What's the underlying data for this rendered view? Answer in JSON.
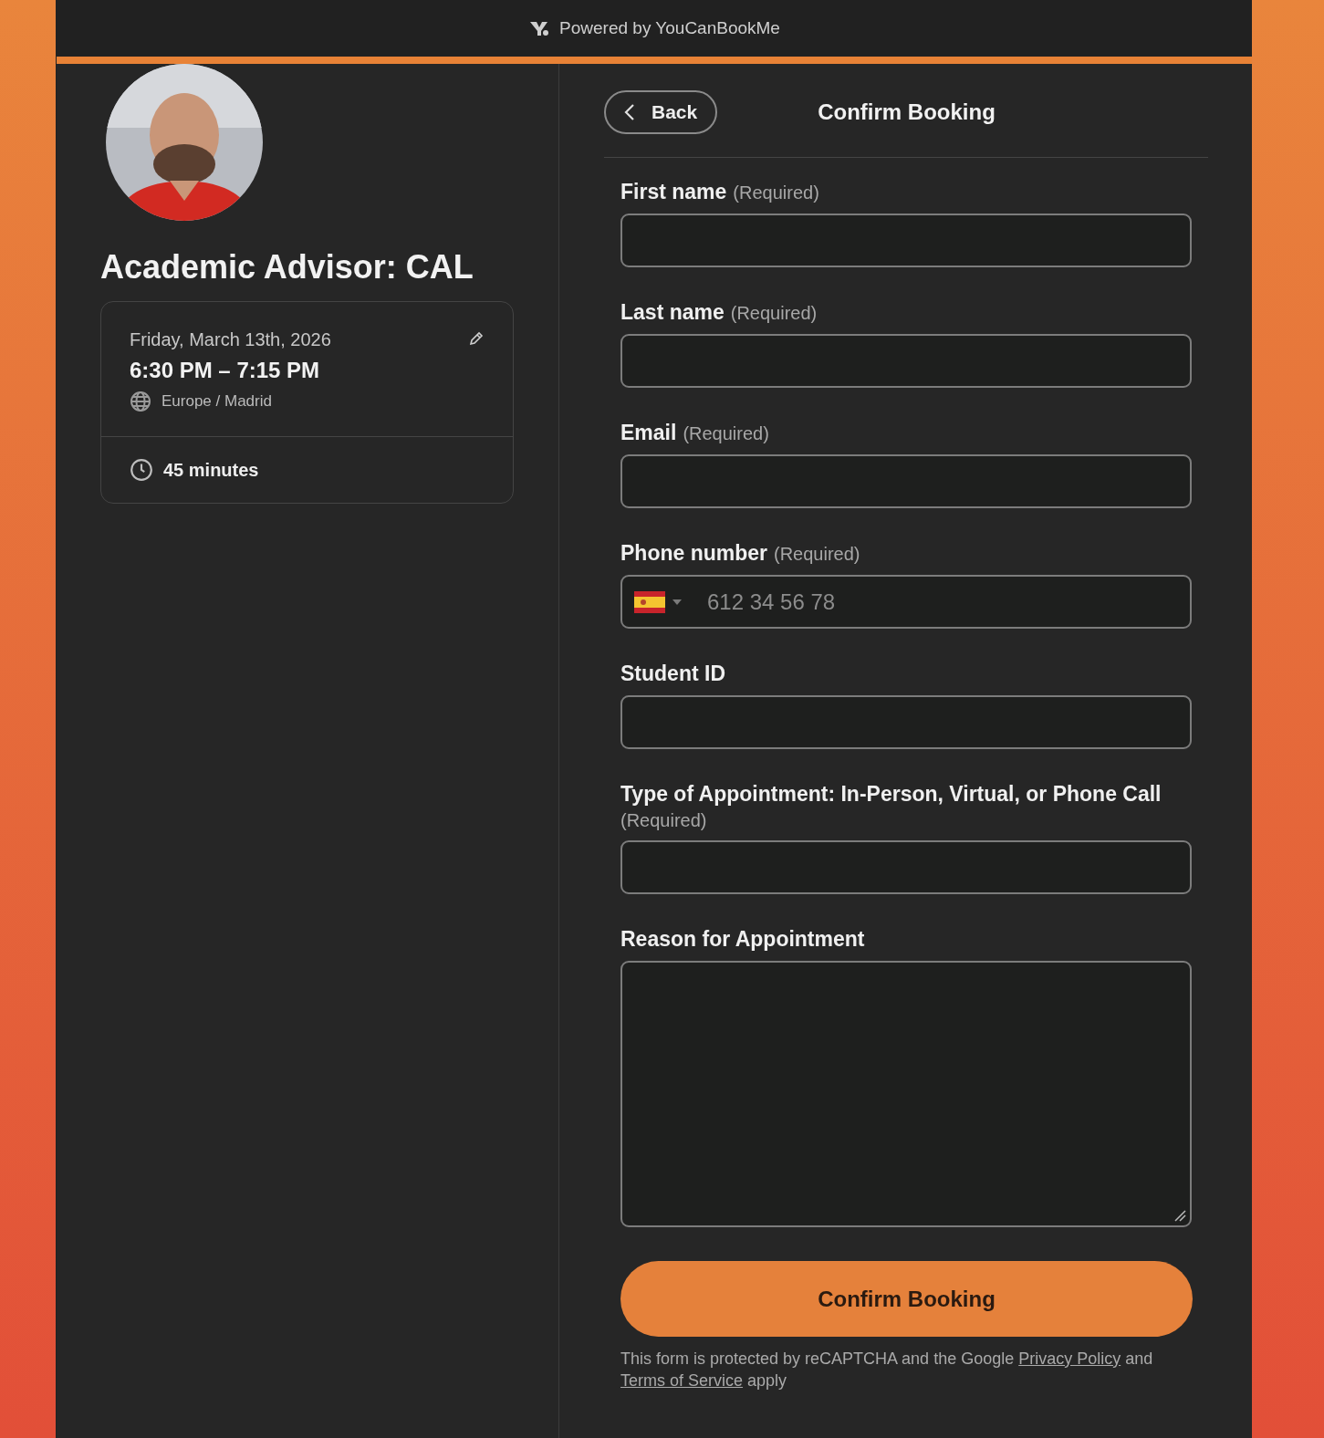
{
  "header": {
    "text": "Powered by YouCanBookMe"
  },
  "profile": {
    "title": "Academic Advisor: CAL"
  },
  "booking": {
    "date": "Friday, March 13th, 2026",
    "time": "6:30 PM – 7:15 PM",
    "timezone": "Europe / Madrid",
    "duration": "45 minutes"
  },
  "form": {
    "back": "Back",
    "title": "Confirm Booking",
    "fields": [
      {
        "kind": "text",
        "label": "First name",
        "note": "(Required)"
      },
      {
        "kind": "text",
        "label": "Last name",
        "note": "(Required)"
      },
      {
        "kind": "text",
        "label": "Email",
        "note": "(Required)"
      },
      {
        "kind": "phone",
        "label": "Phone number",
        "note": "(Required)",
        "placeholder": "612 34 56 78"
      },
      {
        "kind": "text",
        "label": "Student ID"
      },
      {
        "kind": "text",
        "label": "Type of Appointment: In-Person, Virtual, or Phone Call",
        "note": "(Required)"
      },
      {
        "kind": "textarea",
        "label": "Reason for Appointment"
      }
    ],
    "submit": "Confirm Booking",
    "disclaimer": [
      {
        "kind": "text",
        "text": "This form is protected by reCAPTCHA and the Google "
      },
      {
        "kind": "link",
        "text": "Privacy Policy"
      },
      {
        "kind": "text",
        "text": " and "
      },
      {
        "kind": "link",
        "text": "Terms of Service"
      },
      {
        "kind": "text",
        "text": " apply"
      }
    ]
  }
}
